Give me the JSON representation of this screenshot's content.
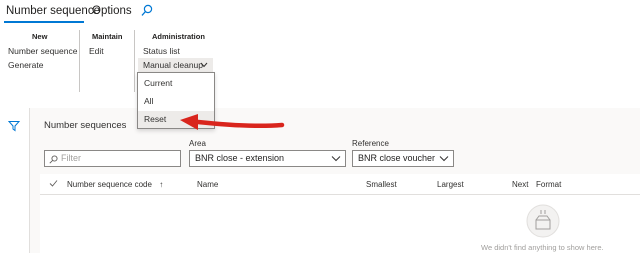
{
  "tabs": {
    "active": "Number sequence",
    "options": "Options",
    "search_icon": "search-icon"
  },
  "ribbon": {
    "groups": {
      "new": {
        "title": "New",
        "items": [
          "Number sequence",
          "Generate"
        ]
      },
      "maintain": {
        "title": "Maintain",
        "items": [
          "Edit"
        ]
      },
      "administration": {
        "title": "Administration",
        "items": [
          "Status list"
        ],
        "dropdown": "Manual cleanup"
      }
    }
  },
  "dropdown_menu": {
    "items": [
      "Current",
      "All",
      "Reset"
    ],
    "highlighted": "Reset"
  },
  "annotation": {
    "arrow_color": "#d9251d"
  },
  "content": {
    "section_title": "Number sequences",
    "filter": {
      "placeholder": "Filter"
    },
    "area": {
      "label": "Area",
      "value": "BNR close - extension"
    },
    "reference": {
      "label": "Reference",
      "value": "BNR close voucher"
    }
  },
  "grid": {
    "columns": [
      "Number sequence code",
      "Name",
      "Smallest",
      "Largest",
      "Next",
      "Format"
    ],
    "sort_indicator": "↑",
    "rows": [],
    "empty_message": "We didn't find anything to show here."
  },
  "colors": {
    "accent": "#0078d4",
    "arrow": "#d9251d",
    "highlight": "#edebe9"
  }
}
